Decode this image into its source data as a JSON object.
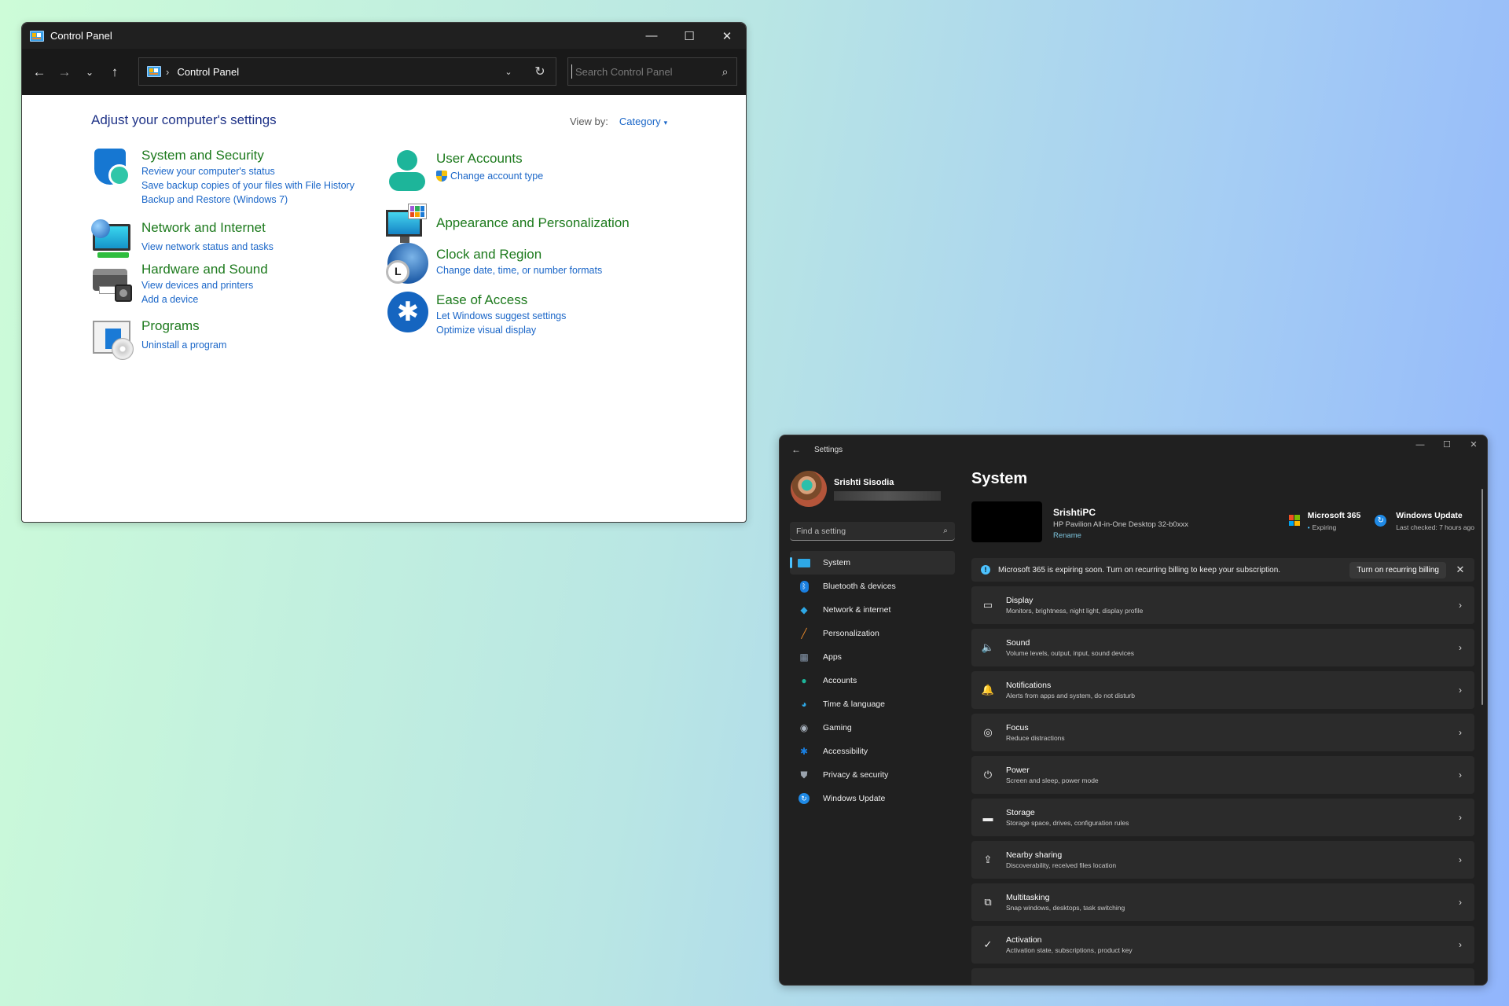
{
  "control_panel": {
    "window_title": "Control Panel",
    "window_controls": {
      "minimize": "—",
      "maximize": "☐",
      "close": "✕"
    },
    "nav": {
      "back": "←",
      "forward": "→",
      "recent": "⌄",
      "up": "↑"
    },
    "address": {
      "separator": "›",
      "location": "Control Panel",
      "dropdown": "⌄",
      "refresh": "↻"
    },
    "search": {
      "placeholder": "Search Control Panel",
      "value": "",
      "icon": "⌕"
    },
    "heading": "Adjust your computer's settings",
    "view_by": {
      "label": "View by:",
      "value": "Category",
      "caret": "▾"
    },
    "categories": [
      {
        "icon": "shield-icon",
        "title": "System and Security",
        "links": [
          "Review your computer's status",
          "Save backup copies of your files with File History",
          "Backup and Restore (Windows 7)"
        ]
      },
      {
        "icon": "network-icon",
        "title": "Network and Internet",
        "links": [
          "View network status and tasks"
        ]
      },
      {
        "icon": "printer-icon",
        "title": "Hardware and Sound",
        "links": [
          "View devices and printers",
          "Add a device"
        ]
      },
      {
        "icon": "programs-icon",
        "title": "Programs",
        "links": [
          "Uninstall a program"
        ]
      },
      {
        "icon": "user-icon",
        "title": "User Accounts",
        "links": [
          "Change account type"
        ]
      },
      {
        "icon": "appearance-icon",
        "title": "Appearance and Personalization",
        "links": []
      },
      {
        "icon": "clock-globe-icon",
        "title": "Clock and Region",
        "links": [
          "Change date, time, or number formats"
        ]
      },
      {
        "icon": "ease-of-access-icon",
        "title": "Ease of Access",
        "links": [
          "Let Windows suggest settings",
          "Optimize visual display"
        ]
      }
    ]
  },
  "settings": {
    "app_title": "Settings",
    "back": "←",
    "window_controls": {
      "minimize": "—",
      "maximize": "☐",
      "close": "✕"
    },
    "user": {
      "name": "Srishti Sisodia"
    },
    "search": {
      "placeholder": "Find a setting",
      "value": "",
      "icon": "⌕"
    },
    "nav": [
      {
        "label": "System",
        "icon": "system-icon",
        "active": true
      },
      {
        "label": "Bluetooth & devices",
        "icon": "bluetooth-icon"
      },
      {
        "label": "Network & internet",
        "icon": "wifi-icon"
      },
      {
        "label": "Personalization",
        "icon": "brush-icon"
      },
      {
        "label": "Apps",
        "icon": "apps-icon"
      },
      {
        "label": "Accounts",
        "icon": "accounts-icon"
      },
      {
        "label": "Time & language",
        "icon": "time-language-icon"
      },
      {
        "label": "Gaming",
        "icon": "gaming-icon"
      },
      {
        "label": "Accessibility",
        "icon": "accessibility-icon"
      },
      {
        "label": "Privacy & security",
        "icon": "privacy-shield-icon"
      },
      {
        "label": "Windows Update",
        "icon": "windows-update-icon"
      }
    ],
    "page_title": "System",
    "device": {
      "name": "SrishtiPC",
      "model": "HP Pavilion All-in-One Desktop 32-b0xxx",
      "rename": "Rename"
    },
    "tiles": [
      {
        "title": "Microsoft 365",
        "subtitle": "Expiring",
        "bullet": "•"
      },
      {
        "title": "Windows Update",
        "subtitle": "Last checked: 7 hours ago"
      }
    ],
    "banner": {
      "text": "Microsoft 365 is expiring soon. Turn on recurring billing to keep your subscription.",
      "button": "Turn on recurring billing",
      "close": "✕",
      "info": "!"
    },
    "chevron": "›",
    "cards": [
      {
        "icon": "display-icon",
        "glyph": "▭",
        "title": "Display",
        "subtitle": "Monitors, brightness, night light, display profile"
      },
      {
        "icon": "sound-icon",
        "glyph": "🔈",
        "title": "Sound",
        "subtitle": "Volume levels, output, input, sound devices"
      },
      {
        "icon": "bell-icon",
        "glyph": "🔔",
        "title": "Notifications",
        "subtitle": "Alerts from apps and system, do not disturb"
      },
      {
        "icon": "focus-icon",
        "glyph": "◎",
        "title": "Focus",
        "subtitle": "Reduce distractions"
      },
      {
        "icon": "power-icon",
        "glyph": "⏻",
        "title": "Power",
        "subtitle": "Screen and sleep, power mode"
      },
      {
        "icon": "storage-icon",
        "glyph": "▬",
        "title": "Storage",
        "subtitle": "Storage space, drives, configuration rules"
      },
      {
        "icon": "share-icon",
        "glyph": "⇪",
        "title": "Nearby sharing",
        "subtitle": "Discoverability, received files location"
      },
      {
        "icon": "multitasking-icon",
        "glyph": "⧉",
        "title": "Multitasking",
        "subtitle": "Snap windows, desktops, task switching"
      },
      {
        "icon": "check-circle-icon",
        "glyph": "✓",
        "title": "Activation",
        "subtitle": "Activation state, subscriptions, product key"
      },
      {
        "icon": "more-icon",
        "glyph": "",
        "title": "",
        "subtitle": ""
      }
    ]
  }
}
